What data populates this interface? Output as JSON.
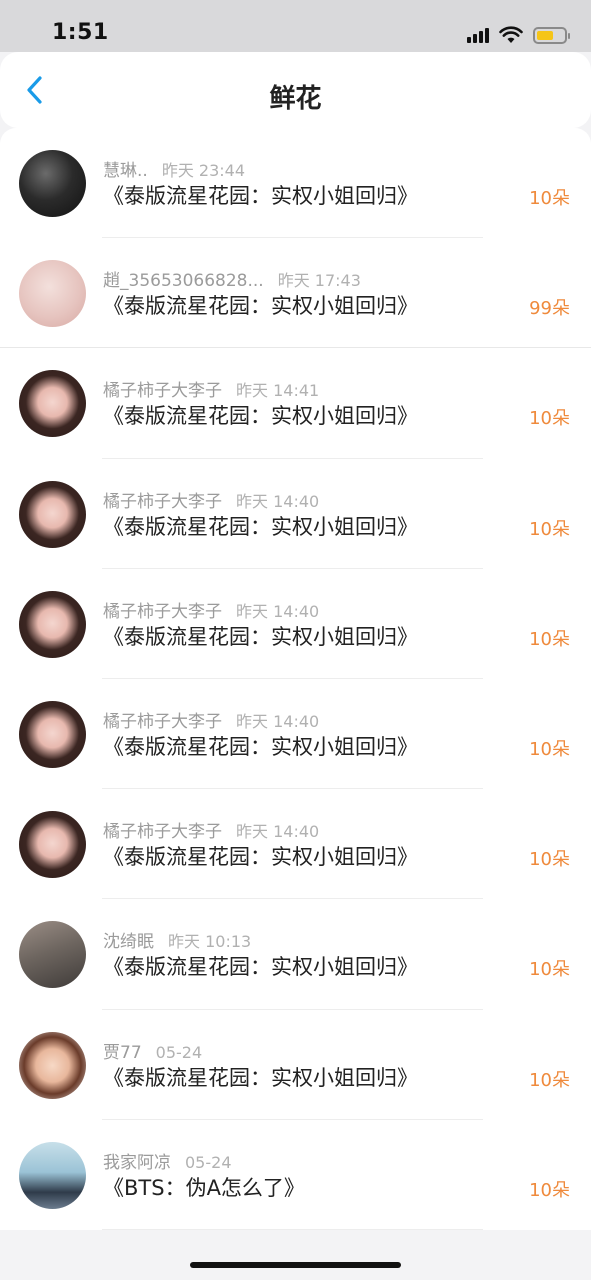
{
  "status_bar": {
    "time": "1:51"
  },
  "nav": {
    "title": "鲜花"
  },
  "items": [
    {
      "user": "慧琳..",
      "time": "昨天 23:44",
      "book": "《泰版流星花园：实权小姐回归》",
      "amount": "10朵",
      "avatar": "dark"
    },
    {
      "user": "趙_35653066828...",
      "time": "昨天 17:43",
      "book": "《泰版流星花园：实权小姐回归》",
      "amount": "99朵",
      "avatar": "pink"
    },
    {
      "user": "橘子柿子大李子",
      "time": "昨天 14:41",
      "book": "《泰版流星花园：实权小姐回归》",
      "amount": "10朵",
      "avatar": "girl"
    },
    {
      "user": "橘子柿子大李子",
      "time": "昨天 14:40",
      "book": "《泰版流星花园：实权小姐回归》",
      "amount": "10朵",
      "avatar": "girl"
    },
    {
      "user": "橘子柿子大李子",
      "time": "昨天 14:40",
      "book": "《泰版流星花园：实权小姐回归》",
      "amount": "10朵",
      "avatar": "girl"
    },
    {
      "user": "橘子柿子大李子",
      "time": "昨天 14:40",
      "book": "《泰版流星花园：实权小姐回归》",
      "amount": "10朵",
      "avatar": "girl"
    },
    {
      "user": "橘子柿子大李子",
      "time": "昨天 14:40",
      "book": "《泰版流星花园：实权小姐回归》",
      "amount": "10朵",
      "avatar": "girl"
    },
    {
      "user": "沈绮眠",
      "time": "昨天 10:13",
      "book": "《泰版流星花园：实权小姐回归》",
      "amount": "10朵",
      "avatar": "street"
    },
    {
      "user": "贾77",
      "time": "05-24",
      "book": "《泰版流星花园：实权小姐回归》",
      "amount": "10朵",
      "avatar": "girl2"
    },
    {
      "user": "我家阿凉",
      "time": "05-24",
      "book": "《BTS：伪A怎么了》",
      "amount": "10朵",
      "avatar": "boy"
    }
  ],
  "colors": {
    "accent": "#1a9be8",
    "amount": "#ef8a3c",
    "battery": "#f5c518"
  }
}
